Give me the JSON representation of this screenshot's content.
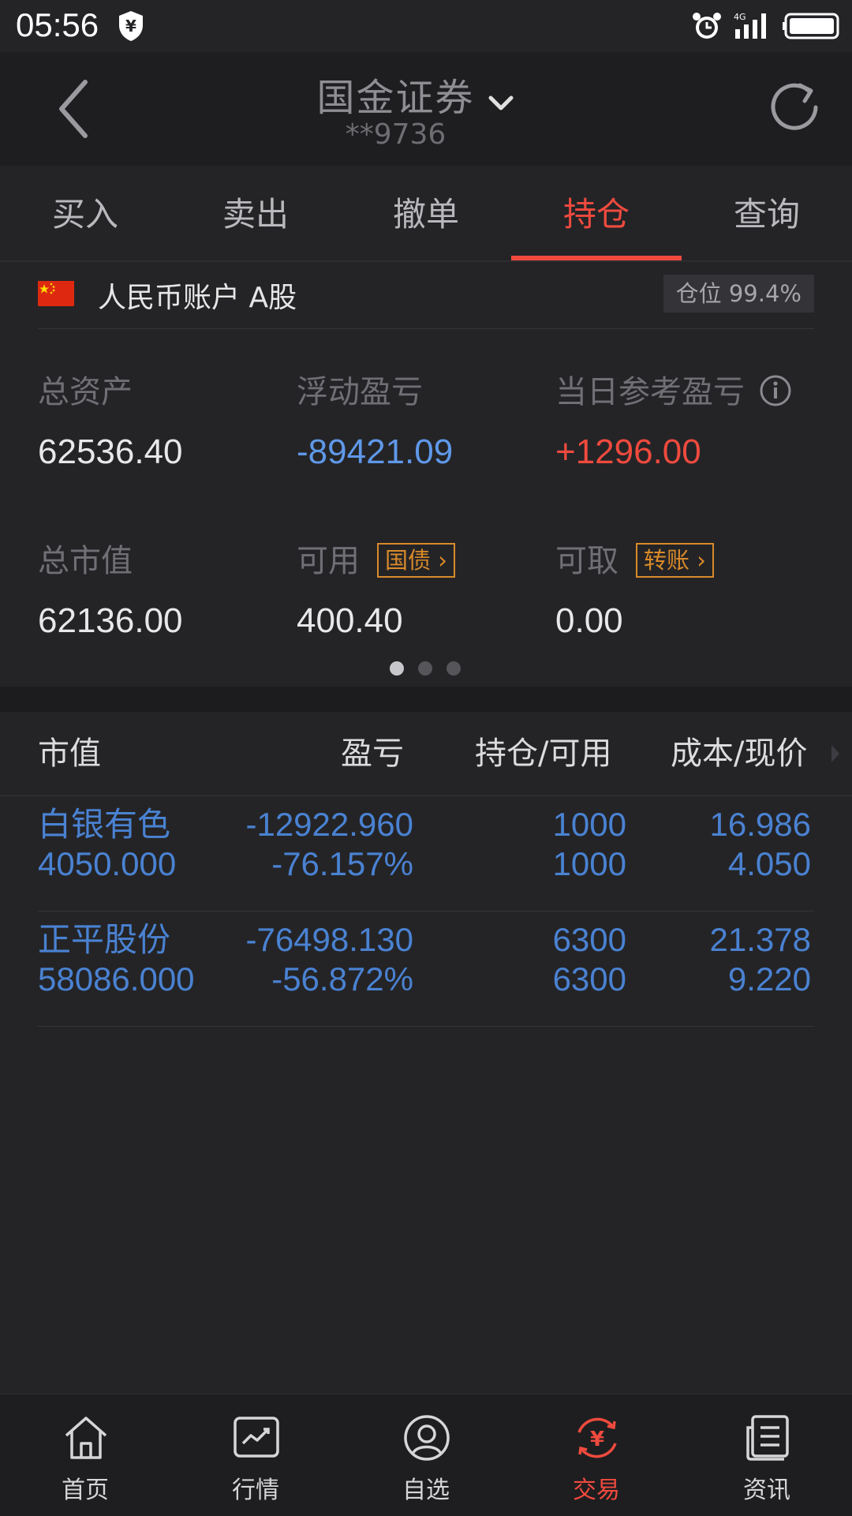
{
  "status": {
    "time": "05:56",
    "network": "4G"
  },
  "header": {
    "broker": "国金证券",
    "account": "**9736"
  },
  "tabs": [
    {
      "label": "买入",
      "active": false
    },
    {
      "label": "卖出",
      "active": false
    },
    {
      "label": "撤单",
      "active": false
    },
    {
      "label": "持仓",
      "active": true
    },
    {
      "label": "查询",
      "active": false
    }
  ],
  "account": {
    "label": "人民币账户 A股",
    "position": "仓位 99.4%"
  },
  "summary": {
    "total_assets": {
      "label": "总资产",
      "value": "62536.40"
    },
    "floating_pl": {
      "label": "浮动盈亏",
      "value": "-89421.09"
    },
    "daily_pl": {
      "label": "当日参考盈亏",
      "value": "+1296.00"
    },
    "market_value": {
      "label": "总市值",
      "value": "62136.00"
    },
    "available": {
      "label": "可用",
      "value": "400.40",
      "tag": "国债"
    },
    "withdrawable": {
      "label": "可取",
      "value": "0.00",
      "tag": "转账"
    }
  },
  "pager": {
    "count": 3,
    "active": 0
  },
  "table": {
    "headers": [
      "市值",
      "盈亏",
      "持仓/可用",
      "成本/现价"
    ],
    "rows": [
      {
        "name": "白银有色",
        "market_value": "4050.000",
        "pl": "-12922.960",
        "pl_pct": "-76.157%",
        "holding": "1000",
        "available": "1000",
        "cost": "16.986",
        "price": "4.050"
      },
      {
        "name": "正平股份",
        "market_value": "58086.000",
        "pl": "-76498.130",
        "pl_pct": "-56.872%",
        "holding": "6300",
        "available": "6300",
        "cost": "21.378",
        "price": "9.220"
      }
    ]
  },
  "colors": {
    "accent": "#f04a3e",
    "loss": "#4a82d2",
    "tag": "#d98a29"
  },
  "nav": [
    {
      "label": "首页",
      "icon": "home-icon"
    },
    {
      "label": "行情",
      "icon": "chart-icon"
    },
    {
      "label": "自选",
      "icon": "user-icon"
    },
    {
      "label": "交易",
      "icon": "yuan-exchange-icon",
      "active": true
    },
    {
      "label": "资讯",
      "icon": "news-icon"
    }
  ]
}
